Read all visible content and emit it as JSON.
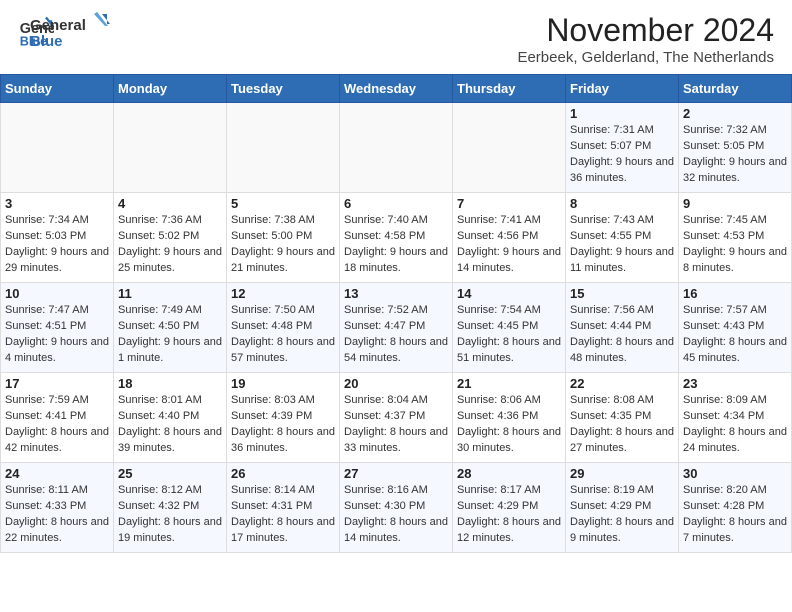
{
  "header": {
    "logo_line1": "General",
    "logo_line2": "Blue",
    "month_title": "November 2024",
    "location": "Eerbeek, Gelderland, The Netherlands"
  },
  "weekdays": [
    "Sunday",
    "Monday",
    "Tuesday",
    "Wednesday",
    "Thursday",
    "Friday",
    "Saturday"
  ],
  "weeks": [
    [
      {
        "day": "",
        "detail": ""
      },
      {
        "day": "",
        "detail": ""
      },
      {
        "day": "",
        "detail": ""
      },
      {
        "day": "",
        "detail": ""
      },
      {
        "day": "",
        "detail": ""
      },
      {
        "day": "1",
        "detail": "Sunrise: 7:31 AM\nSunset: 5:07 PM\nDaylight: 9 hours and 36 minutes."
      },
      {
        "day": "2",
        "detail": "Sunrise: 7:32 AM\nSunset: 5:05 PM\nDaylight: 9 hours and 32 minutes."
      }
    ],
    [
      {
        "day": "3",
        "detail": "Sunrise: 7:34 AM\nSunset: 5:03 PM\nDaylight: 9 hours and 29 minutes."
      },
      {
        "day": "4",
        "detail": "Sunrise: 7:36 AM\nSunset: 5:02 PM\nDaylight: 9 hours and 25 minutes."
      },
      {
        "day": "5",
        "detail": "Sunrise: 7:38 AM\nSunset: 5:00 PM\nDaylight: 9 hours and 21 minutes."
      },
      {
        "day": "6",
        "detail": "Sunrise: 7:40 AM\nSunset: 4:58 PM\nDaylight: 9 hours and 18 minutes."
      },
      {
        "day": "7",
        "detail": "Sunrise: 7:41 AM\nSunset: 4:56 PM\nDaylight: 9 hours and 14 minutes."
      },
      {
        "day": "8",
        "detail": "Sunrise: 7:43 AM\nSunset: 4:55 PM\nDaylight: 9 hours and 11 minutes."
      },
      {
        "day": "9",
        "detail": "Sunrise: 7:45 AM\nSunset: 4:53 PM\nDaylight: 9 hours and 8 minutes."
      }
    ],
    [
      {
        "day": "10",
        "detail": "Sunrise: 7:47 AM\nSunset: 4:51 PM\nDaylight: 9 hours and 4 minutes."
      },
      {
        "day": "11",
        "detail": "Sunrise: 7:49 AM\nSunset: 4:50 PM\nDaylight: 9 hours and 1 minute."
      },
      {
        "day": "12",
        "detail": "Sunrise: 7:50 AM\nSunset: 4:48 PM\nDaylight: 8 hours and 57 minutes."
      },
      {
        "day": "13",
        "detail": "Sunrise: 7:52 AM\nSunset: 4:47 PM\nDaylight: 8 hours and 54 minutes."
      },
      {
        "day": "14",
        "detail": "Sunrise: 7:54 AM\nSunset: 4:45 PM\nDaylight: 8 hours and 51 minutes."
      },
      {
        "day": "15",
        "detail": "Sunrise: 7:56 AM\nSunset: 4:44 PM\nDaylight: 8 hours and 48 minutes."
      },
      {
        "day": "16",
        "detail": "Sunrise: 7:57 AM\nSunset: 4:43 PM\nDaylight: 8 hours and 45 minutes."
      }
    ],
    [
      {
        "day": "17",
        "detail": "Sunrise: 7:59 AM\nSunset: 4:41 PM\nDaylight: 8 hours and 42 minutes."
      },
      {
        "day": "18",
        "detail": "Sunrise: 8:01 AM\nSunset: 4:40 PM\nDaylight: 8 hours and 39 minutes."
      },
      {
        "day": "19",
        "detail": "Sunrise: 8:03 AM\nSunset: 4:39 PM\nDaylight: 8 hours and 36 minutes."
      },
      {
        "day": "20",
        "detail": "Sunrise: 8:04 AM\nSunset: 4:37 PM\nDaylight: 8 hours and 33 minutes."
      },
      {
        "day": "21",
        "detail": "Sunrise: 8:06 AM\nSunset: 4:36 PM\nDaylight: 8 hours and 30 minutes."
      },
      {
        "day": "22",
        "detail": "Sunrise: 8:08 AM\nSunset: 4:35 PM\nDaylight: 8 hours and 27 minutes."
      },
      {
        "day": "23",
        "detail": "Sunrise: 8:09 AM\nSunset: 4:34 PM\nDaylight: 8 hours and 24 minutes."
      }
    ],
    [
      {
        "day": "24",
        "detail": "Sunrise: 8:11 AM\nSunset: 4:33 PM\nDaylight: 8 hours and 22 minutes."
      },
      {
        "day": "25",
        "detail": "Sunrise: 8:12 AM\nSunset: 4:32 PM\nDaylight: 8 hours and 19 minutes."
      },
      {
        "day": "26",
        "detail": "Sunrise: 8:14 AM\nSunset: 4:31 PM\nDaylight: 8 hours and 17 minutes."
      },
      {
        "day": "27",
        "detail": "Sunrise: 8:16 AM\nSunset: 4:30 PM\nDaylight: 8 hours and 14 minutes."
      },
      {
        "day": "28",
        "detail": "Sunrise: 8:17 AM\nSunset: 4:29 PM\nDaylight: 8 hours and 12 minutes."
      },
      {
        "day": "29",
        "detail": "Sunrise: 8:19 AM\nSunset: 4:29 PM\nDaylight: 8 hours and 9 minutes."
      },
      {
        "day": "30",
        "detail": "Sunrise: 8:20 AM\nSunset: 4:28 PM\nDaylight: 8 hours and 7 minutes."
      }
    ]
  ]
}
